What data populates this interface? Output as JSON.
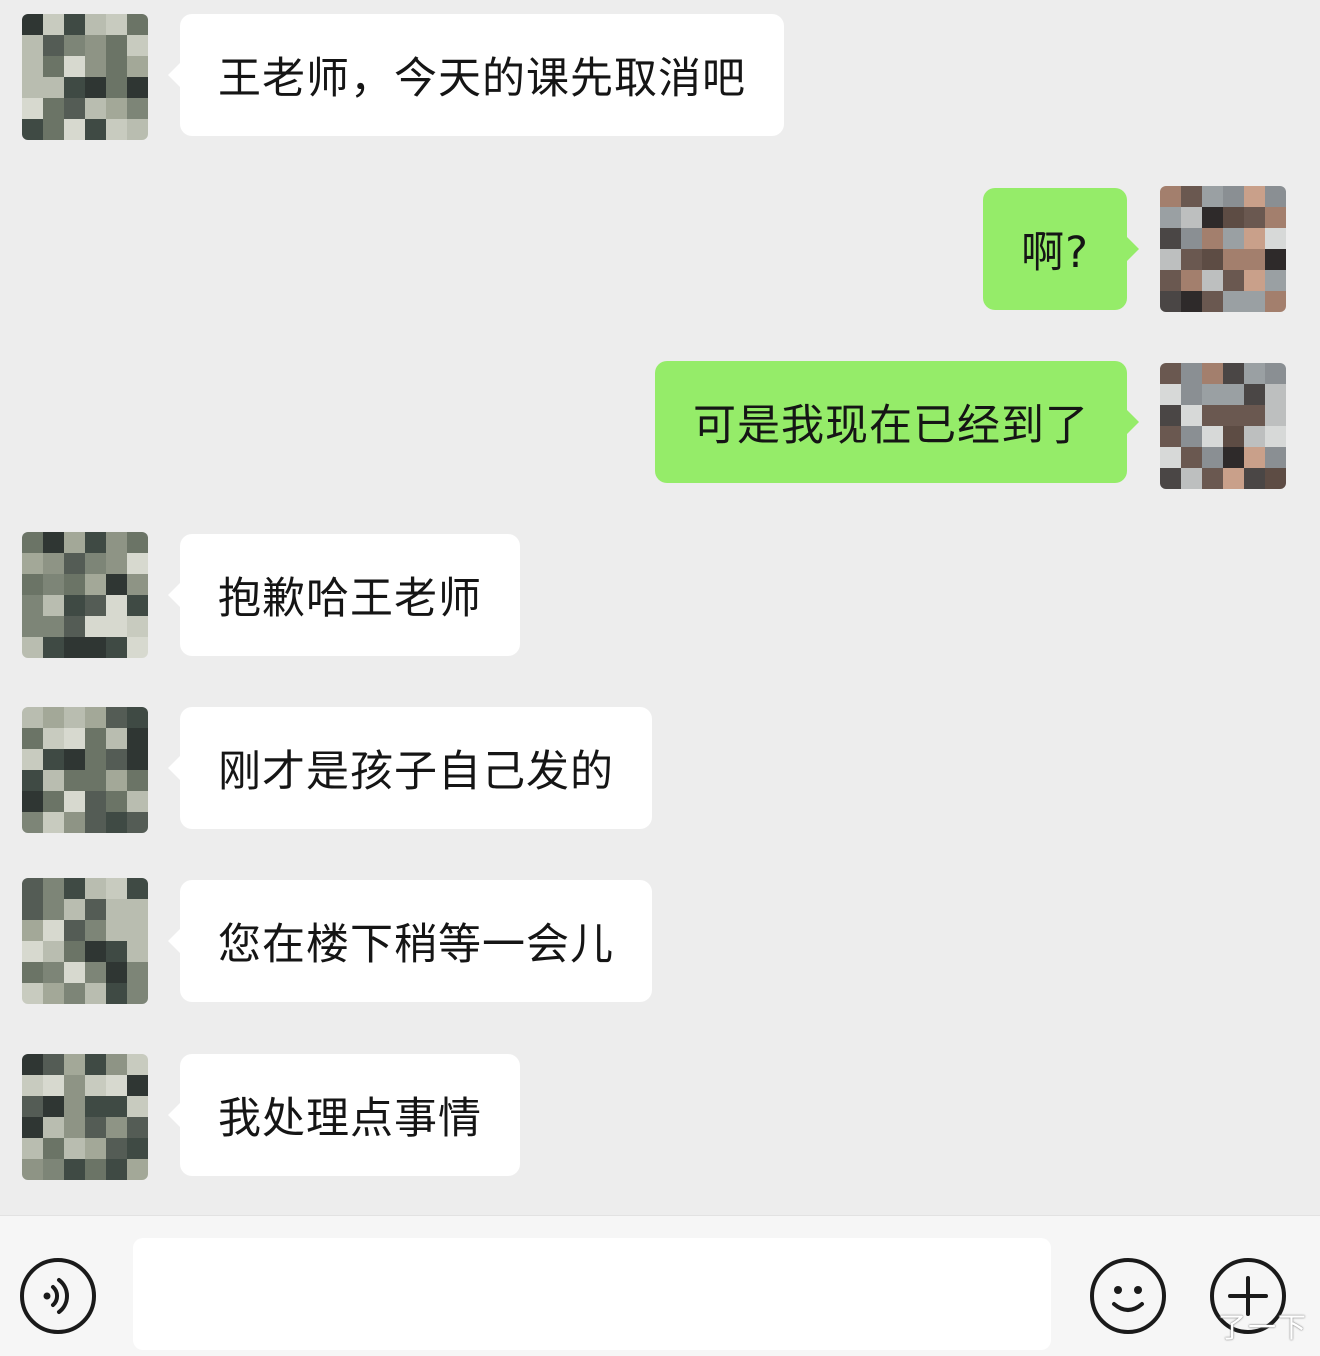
{
  "messages": [
    {
      "side": "in",
      "text": "王老师，今天的课先取消吧"
    },
    {
      "side": "out",
      "text": "啊?"
    },
    {
      "side": "out",
      "text": "可是我现在已经到了"
    },
    {
      "side": "in",
      "text": "抱歉哈王老师"
    },
    {
      "side": "in",
      "text": "刚才是孩子自己发的"
    },
    {
      "side": "in",
      "text": "您在楼下稍等一会儿"
    },
    {
      "side": "in",
      "text": "我处理点事情"
    }
  ],
  "input_bar": {
    "voice_icon": "voice-icon",
    "emoji_icon": "emoji-icon",
    "plus_icon": "plus-icon",
    "text_value": ""
  },
  "watermark": "了一下",
  "colors": {
    "background": "#ededed",
    "incoming_bubble": "#ffffff",
    "outgoing_bubble": "#95ec69",
    "input_bar": "#f6f6f6"
  }
}
